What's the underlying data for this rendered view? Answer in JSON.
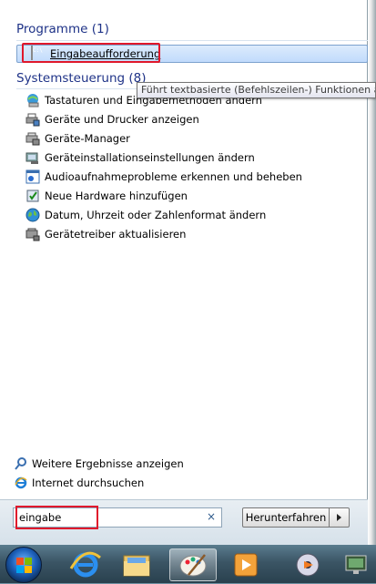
{
  "results": {
    "programs_header": "Programme (1)",
    "programs": [
      {
        "label": "Eingabeaufforderung",
        "icon": "command-prompt-icon"
      }
    ],
    "control_panel_header": "Systemsteuerung (8)",
    "control_panel": [
      {
        "label": "Tastaturen und Eingabemethoden ändern",
        "icon": "globe-keyboard-icon"
      },
      {
        "label": "Geräte und Drucker anzeigen",
        "icon": "printer-devices-icon"
      },
      {
        "label": "Geräte-Manager",
        "icon": "device-manager-icon"
      },
      {
        "label": "Geräteinstallationseinstellungen ändern",
        "icon": "device-installation-icon"
      },
      {
        "label": "Audioaufnahmeprobleme erkennen und beheben",
        "icon": "troubleshoot-audio-icon"
      },
      {
        "label": "Neue Hardware hinzufügen",
        "icon": "add-hardware-icon"
      },
      {
        "label": "Datum, Uhrzeit oder Zahlenformat ändern",
        "icon": "region-globe-icon"
      },
      {
        "label": "Gerätetreiber aktualisieren",
        "icon": "device-driver-icon"
      }
    ]
  },
  "tooltip": "Führt textbasierte (Befehlszeilen-) Funktionen aus",
  "bottom_links": {
    "more_results": "Weitere Ergebnisse anzeigen",
    "search_internet": "Internet durchsuchen"
  },
  "search": {
    "value": "eingabe",
    "clear_icon": "×"
  },
  "shutdown": {
    "label": "Herunterfahren"
  },
  "taskbar": {
    "items": [
      "start-orb",
      "internet-explorer-icon",
      "windows-explorer-icon",
      "paint-icon",
      "media-player-icon",
      "media-center-icon",
      "network-icon"
    ]
  },
  "colors": {
    "header_blue": "#1e3287",
    "highlight_red": "#e0182c",
    "selection_blue": "#c1dbfc"
  }
}
